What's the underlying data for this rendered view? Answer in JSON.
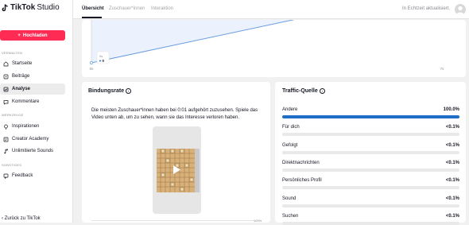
{
  "app": {
    "brand": "TikTok",
    "product": "Studio"
  },
  "sidebar": {
    "upload_label": "Hochladen",
    "sections": {
      "verwalten": "VERWALTEN",
      "werkzeuge": "WERKZEUGE",
      "sonstiges": "SONSTIGES"
    },
    "items": [
      {
        "label": "Startseite",
        "icon": "home-icon"
      },
      {
        "label": "Beiträge",
        "icon": "posts-icon"
      },
      {
        "label": "Analyse",
        "icon": "analytics-icon",
        "active": true
      },
      {
        "label": "Kommentare",
        "icon": "comment-icon"
      },
      {
        "label": "Inspirationen",
        "icon": "bulb-icon"
      },
      {
        "label": "Creator Academy",
        "icon": "academy-icon"
      },
      {
        "label": "Unlimitierte Sounds",
        "icon": "music-icon"
      },
      {
        "label": "Feedback",
        "icon": "feedback-icon"
      }
    ],
    "back_label": "Zurück zu TikTok"
  },
  "header": {
    "tabs": [
      "Übersicht",
      "Zuschauer*innen",
      "Interaktion"
    ],
    "active_tab": 0,
    "status": "In Echtzeit aktualisiert."
  },
  "chart_data": {
    "type": "line",
    "x": [
      "0s",
      "7s"
    ],
    "series": [
      {
        "values": [
          0,
          1
        ]
      }
    ],
    "tooltip": {
      "x": "0s",
      "y": "0"
    },
    "grid": false
  },
  "retention": {
    "title": "Bindungsrate",
    "description": "Die meisten Zuschauer*innen haben bei 0:01 aufgehört zuzusehen. Spiele das Video unten ab, um zu sehen, wann sie das Interesse verloren haben.",
    "progress_end": "100%"
  },
  "traffic": {
    "title": "Traffic-Quelle",
    "rows": [
      {
        "label": "Andere",
        "value": "100.0%",
        "fraction": 1.0
      },
      {
        "label": "Für dich",
        "value": "<0.1%",
        "fraction": 0.0
      },
      {
        "label": "Gefolgt",
        "value": "<0.1%",
        "fraction": 0.0
      },
      {
        "label": "Direktnachrichten",
        "value": "<0.1%",
        "fraction": 0.0
      },
      {
        "label": "Persönliches Profil",
        "value": "<0.1%",
        "fraction": 0.0
      },
      {
        "label": "Sound",
        "value": "<0.1%",
        "fraction": 0.0
      },
      {
        "label": "Suchen",
        "value": "<0.1%",
        "fraction": 0.0
      }
    ]
  },
  "colors": {
    "accent": "#fe2c55",
    "bar": "#1e6ec8",
    "chart_line": "#6a9de0"
  }
}
